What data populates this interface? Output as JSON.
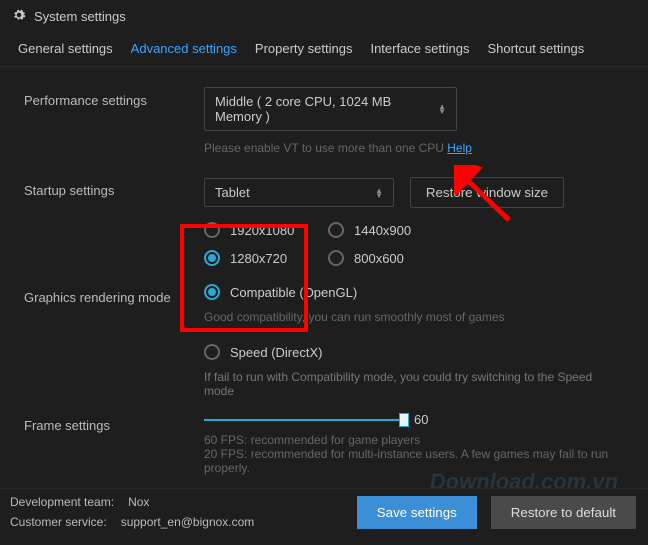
{
  "window": {
    "title": "System settings"
  },
  "tabs": {
    "general": "General settings",
    "advanced": "Advanced settings",
    "property": "Property settings",
    "interface": "Interface settings",
    "shortcut": "Shortcut settings"
  },
  "perf": {
    "label": "Performance settings",
    "value": "Middle ( 2 core CPU, 1024 MB Memory )",
    "hint_prefix": "Please enable VT to use more than one CPU ",
    "hint_link": "Help"
  },
  "startup": {
    "label": "Startup settings",
    "value": "Tablet",
    "restore_btn": "Restore window size",
    "res": {
      "r1": "1920x1080",
      "r2": "1440x900",
      "r3": "1280x720",
      "r4": "800x600"
    }
  },
  "render": {
    "label": "Graphics rendering mode",
    "opt_compatible": "Compatible (OpenGL)",
    "compat_hint": "Good compatibility, you can run smoothly most of games",
    "opt_speed": "Speed (DirectX)",
    "speed_hint": "If fail to run with Compatibility mode, you could try switching to the Speed mode"
  },
  "frame": {
    "label": "Frame settings",
    "value": "60",
    "hint1": "60 FPS: recommended for game players",
    "hint2": "20 FPS: recommended for multi-instance users. A few games may fail to run properly."
  },
  "footer": {
    "dev_label": "Development team:",
    "dev_value": "Nox",
    "cs_label": "Customer service:",
    "cs_value": "support_en@bignox.com",
    "save": "Save settings",
    "restore": "Restore to default"
  },
  "watermark": "Download.com.vn"
}
